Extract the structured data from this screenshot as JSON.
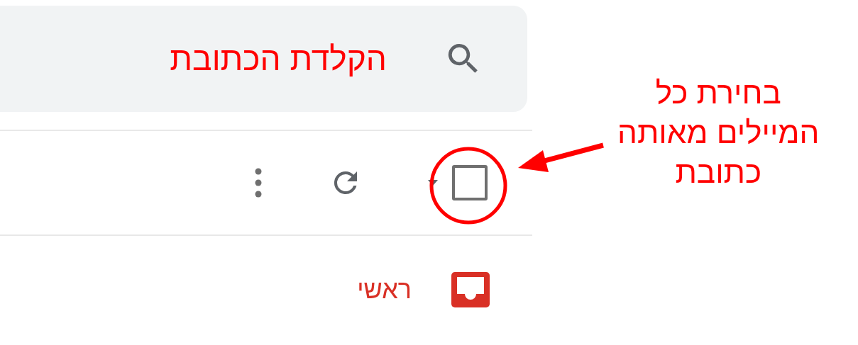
{
  "search": {
    "value": "הקלדת הכתובת"
  },
  "toolbar": {
    "select_all_checked": false
  },
  "tabs": [
    {
      "label": "ראשי",
      "selected": true
    }
  ],
  "annotation": {
    "lines": [
      "בחירת כל",
      "המיילים מאותה",
      "כתובת"
    ]
  }
}
